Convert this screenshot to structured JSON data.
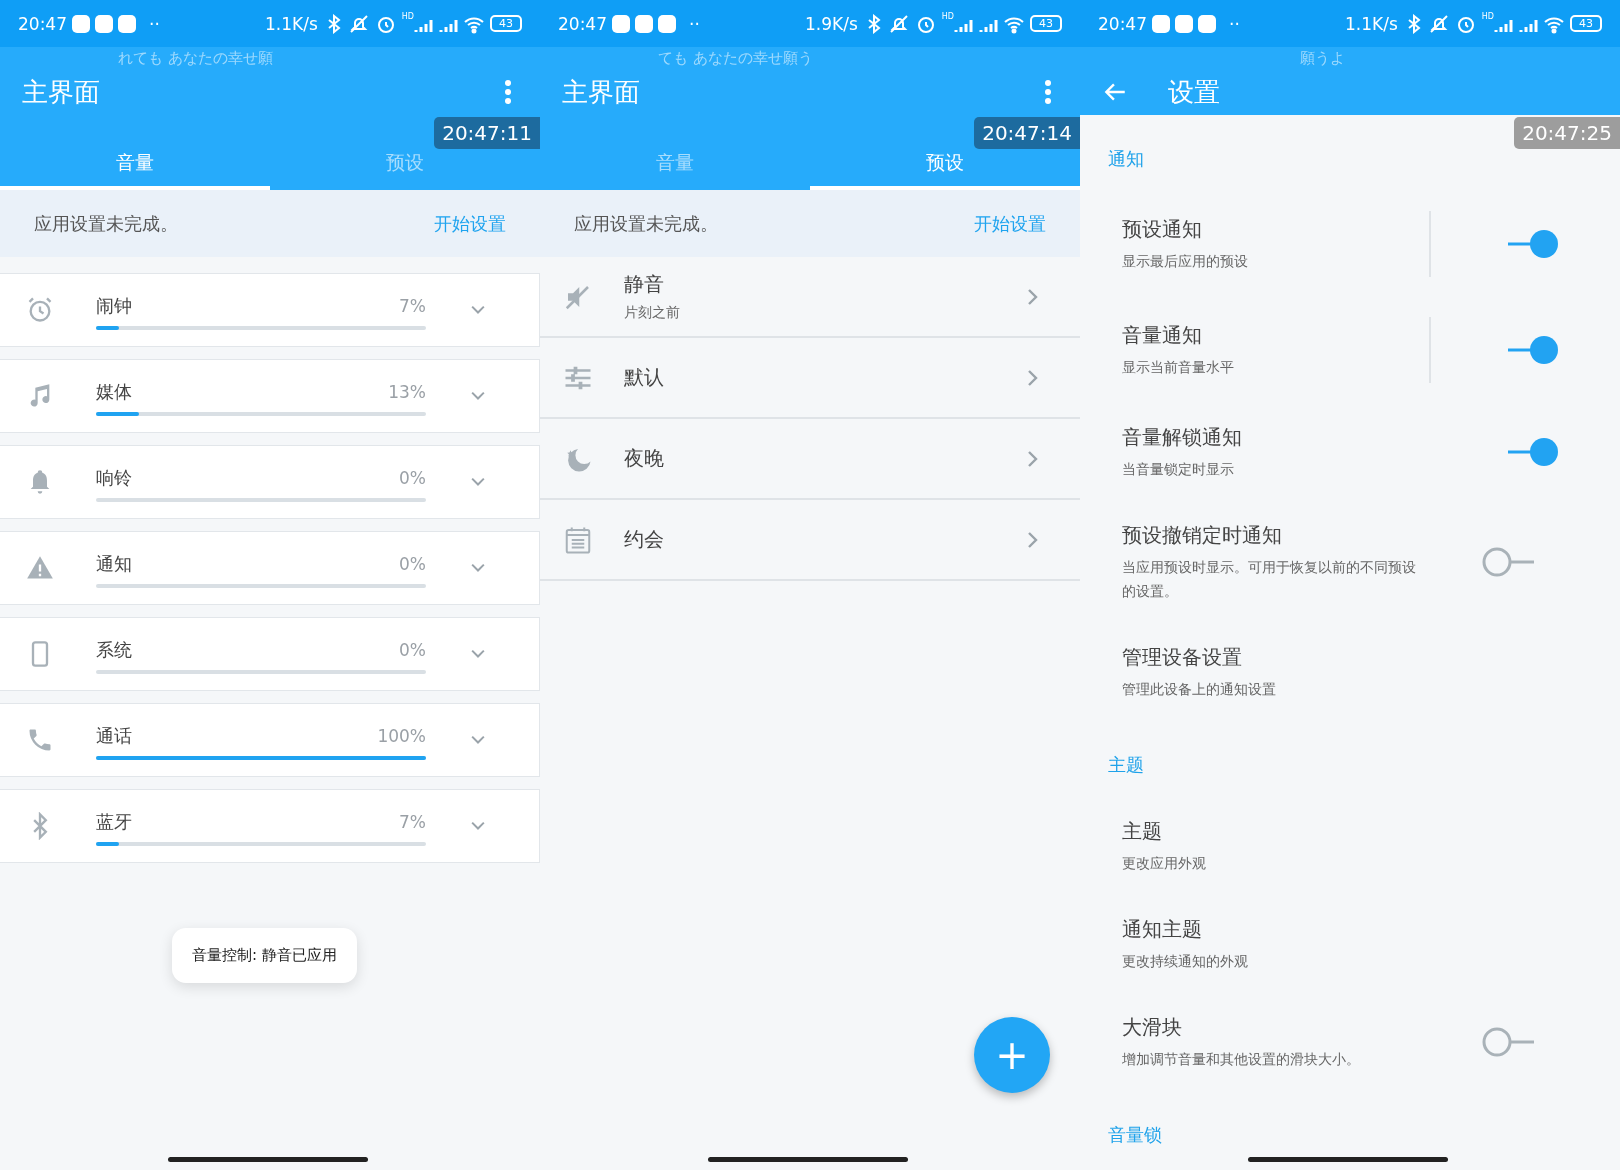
{
  "panels": [
    {
      "kind": "volume",
      "status_bar": {
        "time": "20:47",
        "dots": "··",
        "speed": "1.1K/s",
        "hd": "HD",
        "battery": "43"
      },
      "lyrics": "れても あなたの幸せ願",
      "app_bar": {
        "title": "主界面",
        "back": false,
        "menu": true
      },
      "timestamp": {
        "text": "20:47:11",
        "kind": "dark"
      },
      "tabs": [
        {
          "label": "音量",
          "selected": true
        },
        {
          "label": "预设",
          "selected": false
        }
      ],
      "notice": {
        "text": "应用设置未完成。",
        "action": "开始设置"
      },
      "channels": [
        {
          "kind": "alarm",
          "name": "闹钟",
          "reading": "7%",
          "level": 0.07
        },
        {
          "kind": "music",
          "name": "媒体",
          "reading": "13%",
          "level": 0.13
        },
        {
          "kind": "bell",
          "name": "响铃",
          "reading": "0%",
          "level": 0
        },
        {
          "kind": "warning",
          "name": "通知",
          "reading": "0%",
          "level": 0
        },
        {
          "kind": "phone",
          "name": "系统",
          "reading": "0%",
          "level": 0
        },
        {
          "kind": "call",
          "name": "通话",
          "reading": "100%",
          "level": 1
        },
        {
          "kind": "bluetooth",
          "name": "蓝牙",
          "reading": "7%",
          "level": 0.07
        }
      ],
      "toast": "音量控制: 静音已应用"
    },
    {
      "kind": "presets",
      "status_bar": {
        "time": "20:47",
        "dots": "··",
        "speed": "1.9K/s",
        "hd": "HD",
        "battery": "43"
      },
      "lyrics": "ても あなたの幸せ願う",
      "app_bar": {
        "title": "主界面",
        "back": false,
        "menu": true
      },
      "timestamp": {
        "text": "20:47:14",
        "kind": "dark"
      },
      "tabs": [
        {
          "label": "音量",
          "selected": false
        },
        {
          "label": "预设",
          "selected": true
        }
      ],
      "notice": {
        "text": "应用设置未完成。",
        "action": "开始设置"
      },
      "presets": [
        {
          "kind": "mute",
          "name": "静音",
          "subtitle": "片刻之前"
        },
        {
          "kind": "sliders",
          "name": "默认"
        },
        {
          "kind": "night",
          "name": "夜晚"
        },
        {
          "kind": "calendar",
          "name": "约会"
        }
      ],
      "fab": "+"
    },
    {
      "kind": "settings",
      "status_bar": {
        "time": "20:47",
        "dots": "··",
        "speed": "1.1K/s",
        "hd": "HD",
        "battery": "43"
      },
      "lyrics": "願うよ",
      "app_bar": {
        "title": "设置",
        "back": true,
        "menu": false
      },
      "timestamp": {
        "text": "20:47:25",
        "kind": "grey"
      },
      "sections": [
        {
          "title": "通知",
          "items": [
            {
              "kind": "switch",
              "title": "预设通知",
              "subtitle": "显示最后应用的预设",
              "on": true,
              "split": true
            },
            {
              "kind": "switch",
              "title": "音量通知",
              "subtitle": "显示当前音量水平",
              "on": true,
              "split": true
            },
            {
              "kind": "switch",
              "title": "音量解锁通知",
              "subtitle": "当音量锁定时显示",
              "on": true,
              "split": false
            },
            {
              "kind": "switch",
              "title": "预设撤销定时通知",
              "subtitle": "当应用预设时显示。可用于恢复以前的不同预设的设置。",
              "on": false,
              "split": false
            },
            {
              "kind": "plain",
              "title": "管理设备设置",
              "subtitle": "管理此设备上的通知设置"
            }
          ]
        },
        {
          "title": "主题",
          "items": [
            {
              "kind": "plain",
              "title": "主题",
              "subtitle": "更改应用外观"
            },
            {
              "kind": "plain",
              "title": "通知主题",
              "subtitle": "更改持续通知的外观"
            },
            {
              "kind": "switch",
              "title": "大滑块",
              "subtitle": "增加调节音量和其他设置的滑块大小。",
              "on": false,
              "split": false
            }
          ]
        },
        {
          "title": "音量锁"
        }
      ]
    }
  ]
}
